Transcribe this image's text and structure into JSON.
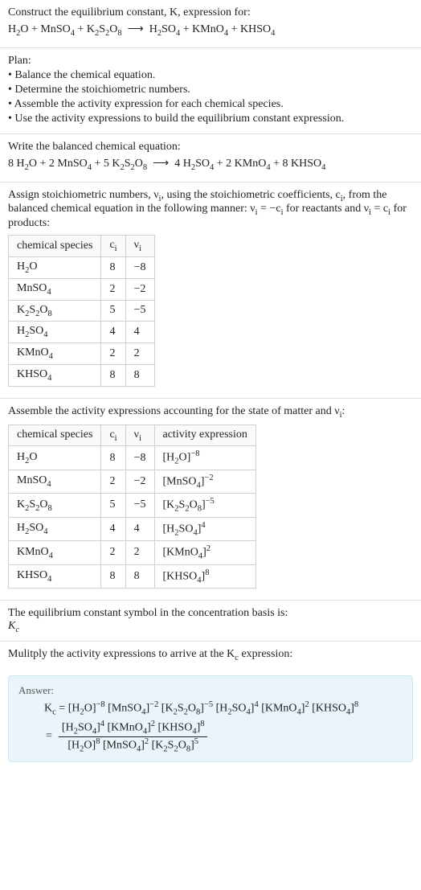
{
  "header": {
    "title_line": "Construct the equilibrium constant, K, expression for:",
    "equation_html": "H<sub>2</sub>O + MnSO<sub>4</sub> + K<sub>2</sub>S<sub>2</sub>O<sub>8</sub> &nbsp;⟶&nbsp; H<sub>2</sub>SO<sub>4</sub> + KMnO<sub>4</sub> + KHSO<sub>4</sub>"
  },
  "plan": {
    "label": "Plan:",
    "bullets": [
      "• Balance the chemical equation.",
      "• Determine the stoichiometric numbers.",
      "• Assemble the activity expression for each chemical species.",
      "• Use the activity expressions to build the equilibrium constant expression."
    ]
  },
  "balanced": {
    "label": "Write the balanced chemical equation:",
    "equation_html": "8 H<sub>2</sub>O + 2 MnSO<sub>4</sub> + 5 K<sub>2</sub>S<sub>2</sub>O<sub>8</sub> &nbsp;⟶&nbsp; 4 H<sub>2</sub>SO<sub>4</sub> + 2 KMnO<sub>4</sub> + 8 KHSO<sub>4</sub>"
  },
  "stoich": {
    "intro_html": "Assign stoichiometric numbers, ν<sub>i</sub>, using the stoichiometric coefficients, c<sub>i</sub>, from the balanced chemical equation in the following manner: ν<sub>i</sub> = −c<sub>i</sub> for reactants and ν<sub>i</sub> = c<sub>i</sub> for products:",
    "headers": {
      "species": "chemical species",
      "ci_html": "c<sub>i</sub>",
      "vi_html": "ν<sub>i</sub>"
    },
    "rows": [
      {
        "species_html": "H<sub>2</sub>O",
        "ci": "8",
        "vi": "−8"
      },
      {
        "species_html": "MnSO<sub>4</sub>",
        "ci": "2",
        "vi": "−2"
      },
      {
        "species_html": "K<sub>2</sub>S<sub>2</sub>O<sub>8</sub>",
        "ci": "5",
        "vi": "−5"
      },
      {
        "species_html": "H<sub>2</sub>SO<sub>4</sub>",
        "ci": "4",
        "vi": "4"
      },
      {
        "species_html": "KMnO<sub>4</sub>",
        "ci": "2",
        "vi": "2"
      },
      {
        "species_html": "KHSO<sub>4</sub>",
        "ci": "8",
        "vi": "8"
      }
    ]
  },
  "activity": {
    "intro_html": "Assemble the activity expressions accounting for the state of matter and ν<sub>i</sub>:",
    "headers": {
      "species": "chemical species",
      "ci_html": "c<sub>i</sub>",
      "vi_html": "ν<sub>i</sub>",
      "expr": "activity expression"
    },
    "rows": [
      {
        "species_html": "H<sub>2</sub>O",
        "ci": "8",
        "vi": "−8",
        "expr_html": "[H<sub>2</sub>O]<sup>−8</sup>"
      },
      {
        "species_html": "MnSO<sub>4</sub>",
        "ci": "2",
        "vi": "−2",
        "expr_html": "[MnSO<sub>4</sub>]<sup>−2</sup>"
      },
      {
        "species_html": "K<sub>2</sub>S<sub>2</sub>O<sub>8</sub>",
        "ci": "5",
        "vi": "−5",
        "expr_html": "[K<sub>2</sub>S<sub>2</sub>O<sub>8</sub>]<sup>−5</sup>"
      },
      {
        "species_html": "H<sub>2</sub>SO<sub>4</sub>",
        "ci": "4",
        "vi": "4",
        "expr_html": "[H<sub>2</sub>SO<sub>4</sub>]<sup>4</sup>"
      },
      {
        "species_html": "KMnO<sub>4</sub>",
        "ci": "2",
        "vi": "2",
        "expr_html": "[KMnO<sub>4</sub>]<sup>2</sup>"
      },
      {
        "species_html": "KHSO<sub>4</sub>",
        "ci": "8",
        "vi": "8",
        "expr_html": "[KHSO<sub>4</sub>]<sup>8</sup>"
      }
    ]
  },
  "kc_symbol": {
    "label": "The equilibrium constant symbol in the concentration basis is:",
    "symbol_html": "K<sub>c</sub>"
  },
  "multiply": {
    "label_html": "Mulitply the activity expressions to arrive at the K<sub>c</sub> expression:"
  },
  "answer": {
    "label": "Answer:",
    "line1_html": "K<sub>c</sub> = [H<sub>2</sub>O]<sup>−8</sup> [MnSO<sub>4</sub>]<sup>−2</sup> [K<sub>2</sub>S<sub>2</sub>O<sub>8</sub>]<sup>−5</sup> [H<sub>2</sub>SO<sub>4</sub>]<sup>4</sup> [KMnO<sub>4</sub>]<sup>2</sup> [KHSO<sub>4</sub>]<sup>8</sup>",
    "eq_sign": "=",
    "frac_num_html": "[H<sub>2</sub>SO<sub>4</sub>]<sup>4</sup> [KMnO<sub>4</sub>]<sup>2</sup> [KHSO<sub>4</sub>]<sup>8</sup>",
    "frac_den_html": "[H<sub>2</sub>O]<sup>8</sup> [MnSO<sub>4</sub>]<sup>2</sup> [K<sub>2</sub>S<sub>2</sub>O<sub>8</sub>]<sup>5</sup>"
  },
  "chart_data": null
}
